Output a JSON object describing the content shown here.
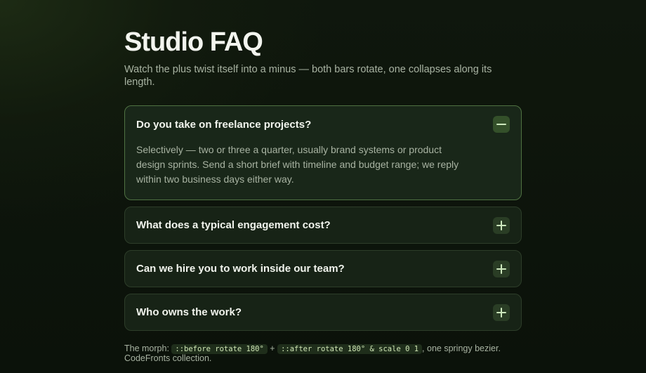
{
  "header": {
    "title": "Studio FAQ",
    "subtitle": "Watch the plus twist itself into a minus — both bars rotate, one collapses along its length."
  },
  "faq": {
    "items": [
      {
        "question": "Do you take on freelance projects?",
        "answer": "Selectively — two or three a quarter, usually brand systems or product design sprints. Send a short brief with timeline and budget range; we reply within two business days either way.",
        "open": true,
        "icon": "minus-icon"
      },
      {
        "question": "What does a typical engagement cost?",
        "open": false,
        "icon": "plus-icon"
      },
      {
        "question": "Can we hire you to work inside our team?",
        "open": false,
        "icon": "plus-icon"
      },
      {
        "question": "Who owns the work?",
        "open": false,
        "icon": "plus-icon"
      }
    ]
  },
  "footer": {
    "prefix": "The morph: ",
    "code1": "::before rotate 180°",
    "plus": " + ",
    "code2": "::after rotate 180° & scale 0 1",
    "suffix": ", one springy bezier. CodeFronts collection."
  },
  "colors": {
    "accent": "#4f7242",
    "background": "#0c130b",
    "card": "#172316",
    "icon_bar": "#cde8bd"
  }
}
